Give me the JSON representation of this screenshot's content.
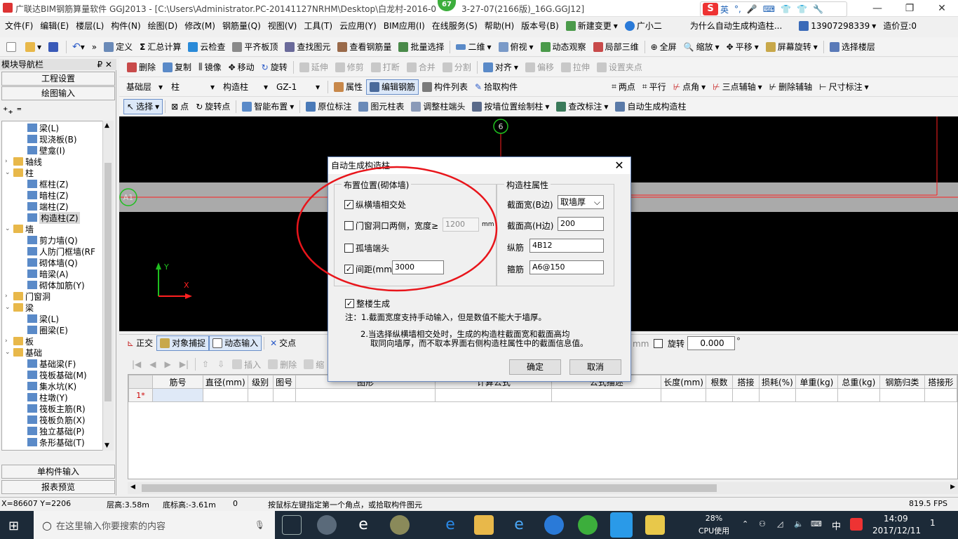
{
  "titlebar": {
    "title": "广联达BIM钢筋算量软件 GGJ2013 - [C:\\Users\\Administrator.PC-20141127NRHM\\Desktop\\白龙村-2016-0",
    "title_tail": "3-27-07(2166版)_16G.GGJ12]",
    "badge": "67",
    "ime_items": [
      "S",
      "英",
      "°,",
      "🎤",
      "⌨",
      "👕",
      "👕",
      "🔧"
    ],
    "controls": [
      "—",
      "❐",
      "✕"
    ]
  },
  "menubar": {
    "items": [
      "文件(F)",
      "编辑(E)",
      "楼层(L)",
      "构件(N)",
      "绘图(D)",
      "修改(M)",
      "钢筋量(Q)",
      "视图(V)",
      "工具(T)",
      "云应用(Y)",
      "BIM应用(I)",
      "在线服务(S)",
      "帮助(H)",
      "版本号(B)",
      "新建变更",
      "广小二"
    ],
    "question": "为什么自动生成构造柱...",
    "phone": "13907298339",
    "beans": "造价豆:0"
  },
  "toolbar1": {
    "items": [
      "定义",
      "汇总计算",
      "云检查",
      "平齐板顶",
      "查找图元",
      "查看钢筋量",
      "批量选择",
      "二维",
      "俯视",
      "动态观察",
      "局部三维",
      "全屏",
      "缩放",
      "平移",
      "屏幕旋转",
      "选择楼层"
    ]
  },
  "toolbar2": {
    "items": [
      "删除",
      "复制",
      "镜像",
      "移动",
      "旋转",
      "延伸",
      "修剪",
      "打断",
      "合并",
      "分割",
      "对齐",
      "偏移",
      "拉伸",
      "设置夹点"
    ]
  },
  "toolbar3": {
    "floor": "基础层",
    "type": "柱",
    "subtype": "构造柱",
    "element": "GZ-1",
    "items": [
      "属性",
      "编辑钢筋",
      "构件列表",
      "拾取构件",
      "两点",
      "平行",
      "点角",
      "三点辅轴",
      "删除辅轴",
      "尺寸标注"
    ]
  },
  "toolbar4": {
    "items": [
      "选择",
      "点",
      "旋转点",
      "智能布置",
      "原位标注",
      "图元柱表",
      "调整柱端头",
      "按墙位置绘制柱",
      "查改标注",
      "自动生成构造柱"
    ]
  },
  "leftpanel": {
    "title": "模块导航栏",
    "pin": "₽  ✕",
    "buttons": [
      "工程设置",
      "绘图输入"
    ],
    "bottom_buttons": [
      "单构件输入",
      "报表预览"
    ],
    "tree": [
      {
        "label": "梁(L)",
        "level": 2,
        "kind": "el"
      },
      {
        "label": "现浇板(B)",
        "level": 2,
        "kind": "el"
      },
      {
        "label": "壁龛(I)",
        "level": 2,
        "kind": "el"
      },
      {
        "label": "轴线",
        "level": 0,
        "kind": "folder",
        "tog": "+"
      },
      {
        "label": "柱",
        "level": 0,
        "kind": "folder",
        "tog": "−"
      },
      {
        "label": "框柱(Z)",
        "level": 2,
        "kind": "el"
      },
      {
        "label": "暗柱(Z)",
        "level": 2,
        "kind": "el"
      },
      {
        "label": "端柱(Z)",
        "level": 2,
        "kind": "el"
      },
      {
        "label": "构造柱(Z)",
        "level": 2,
        "kind": "el",
        "selected": true
      },
      {
        "label": "墙",
        "level": 0,
        "kind": "folder",
        "tog": "−"
      },
      {
        "label": "剪力墙(Q)",
        "level": 2,
        "kind": "el"
      },
      {
        "label": "人防门框墙(RF",
        "level": 2,
        "kind": "el"
      },
      {
        "label": "砌体墙(Q)",
        "level": 2,
        "kind": "el"
      },
      {
        "label": "暗梁(A)",
        "level": 2,
        "kind": "el"
      },
      {
        "label": "砌体加筋(Y)",
        "level": 2,
        "kind": "el"
      },
      {
        "label": "门窗洞",
        "level": 0,
        "kind": "folder",
        "tog": "+"
      },
      {
        "label": "梁",
        "level": 0,
        "kind": "folder",
        "tog": "−"
      },
      {
        "label": "梁(L)",
        "level": 2,
        "kind": "el"
      },
      {
        "label": "圈梁(E)",
        "level": 2,
        "kind": "el"
      },
      {
        "label": "板",
        "level": 0,
        "kind": "folder",
        "tog": "+"
      },
      {
        "label": "基础",
        "level": 0,
        "kind": "folder",
        "tog": "−"
      },
      {
        "label": "基础梁(F)",
        "level": 2,
        "kind": "el"
      },
      {
        "label": "筏板基础(M)",
        "level": 2,
        "kind": "el"
      },
      {
        "label": "集水坑(K)",
        "level": 2,
        "kind": "el"
      },
      {
        "label": "柱墩(Y)",
        "level": 2,
        "kind": "el"
      },
      {
        "label": "筏板主筋(R)",
        "level": 2,
        "kind": "el"
      },
      {
        "label": "筏板负筋(X)",
        "level": 2,
        "kind": "el"
      },
      {
        "label": "独立基础(P)",
        "level": 2,
        "kind": "el"
      },
      {
        "label": "条形基础(T)",
        "level": 2,
        "kind": "el"
      }
    ]
  },
  "canvas": {
    "axis_top": "6",
    "axis_left": "A1",
    "y_label": "Y",
    "x_label": "X"
  },
  "snapbar": {
    "items": [
      "正交",
      "对象捕捉",
      "动态输入",
      "交点"
    ],
    "unit": "mm",
    "rotate_label": "旋转",
    "rotate_value": "0.000"
  },
  "gridbar": {
    "items": [
      "插入",
      "删除",
      "缩"
    ]
  },
  "grid": {
    "columns": [
      "筋号",
      "直径(mm)",
      "级别",
      "图号",
      "图形",
      "计算公式",
      "公式描述",
      "长度(mm)",
      "根数",
      "搭接",
      "损耗(%)",
      "单重(kg)",
      "总重(kg)",
      "钢筋归类",
      "搭接形"
    ],
    "rows": [
      {
        "num": "1*"
      }
    ]
  },
  "statusbar": {
    "coords": "X=86607 Y=2206",
    "floor_height": "层高:3.58m",
    "base_height": "底标高:-3.61m",
    "count": "0",
    "hint": "按鼠标左键指定第一个角点，或拾取构件图元",
    "fps": "819.5 FPS"
  },
  "dialog": {
    "title": "自动生成构造柱",
    "close": "✕",
    "group1_title": "布置位置(砌体墙)",
    "opt1": "纵横墙相交处",
    "opt2": "门窗洞口两侧，宽度≥",
    "opt2_value": "1200",
    "opt2_unit": "mm",
    "opt3": "孤墙端头",
    "opt4": "间距(mm)",
    "opt4_value": "3000",
    "group2_title": "构造柱属性",
    "prop_width_label": "截面宽(B边)",
    "prop_width_value": "取墙厚",
    "prop_height_label": "截面高(H边)",
    "prop_height_value": "200",
    "prop_long_label": "纵筋",
    "prop_long_value": "4B12",
    "prop_stirrup_label": "箍筋",
    "prop_stirrup_value": "A6@150",
    "whole_building": "整楼生成",
    "note1": "注：1.截面宽度支持手动输入，但是数值不能大于墙厚。",
    "note2a": "2.当选择纵横墙相交处时，生成的构造柱截面宽和截面高均",
    "note2b": "取同向墙厚，而不取本界面右侧构造柱属性中的截面信息值。",
    "ok": "确定",
    "cancel": "取消"
  },
  "taskbar": {
    "search_placeholder": "在这里输入你要搜索的内容",
    "cpu_percent": "28%",
    "cpu_label": "CPU使用",
    "lang": "中",
    "time": "14:09",
    "date": "2017/12/11",
    "notif": "1"
  },
  "colors": {
    "annotation_red": "#e8151b",
    "canvas_bg": "#000000",
    "wall_gray": "#aaaaaa",
    "axis_red": "#ff2020",
    "axis_green": "#1fbf1f"
  }
}
